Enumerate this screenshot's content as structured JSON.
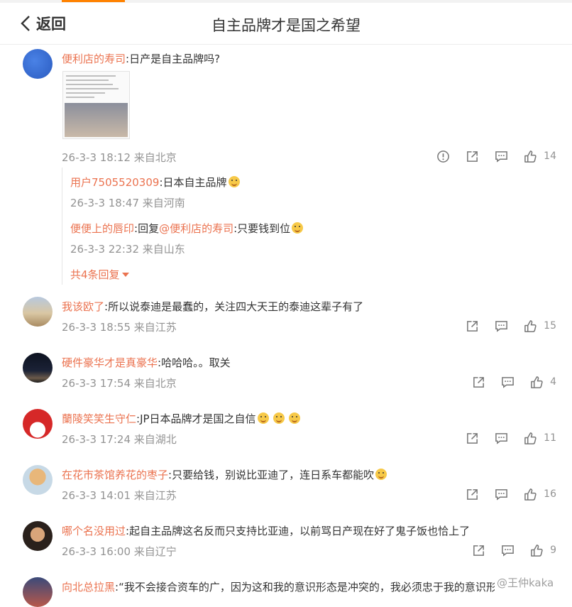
{
  "header": {
    "back_label": "返回",
    "title": "自主品牌才是国之希望"
  },
  "comments": [
    {
      "user": "便利店的寿司",
      "sep": ":",
      "text": "日产是自主品牌吗?",
      "meta": "26-3-3 18:12 来自北京",
      "likes": "14",
      "avatar_color": "#3a6fd8"
    },
    {
      "user": "我该欧了",
      "sep": ":",
      "text": "所以说泰迪是最蠢的，关注四大天王的泰迪这辈子有了",
      "meta": "26-3-3 18:55 来自江苏",
      "likes": "15"
    },
    {
      "user": "硬件豪华才是真豪华",
      "sep": ":",
      "text": "哈哈哈。。取关",
      "meta": "26-3-3 17:54 来自北京",
      "likes": "4"
    },
    {
      "user": "蘭陵笑笑生守仁",
      "sep": ":",
      "text": "JP日本品牌才是国之自信",
      "meta": "26-3-3 17:24 来自湖北",
      "likes": "11"
    },
    {
      "user": "在花市茶馆养花的枣子",
      "sep": ":",
      "text": "只要给钱，别说比亚迪了，连日系车都能吹",
      "meta": "26-3-3 14:01 来自江苏",
      "likes": "16"
    },
    {
      "user": "哪个名没用过",
      "sep": ":",
      "text": "起自主品牌这名反而只支持比亚迪，以前骂日产现在好了鬼子饭也恰上了",
      "meta": "26-3-3 16:00 来自辽宁",
      "likes": "9"
    },
    {
      "user": "向北总拉黑",
      "sep": ":",
      "text": "“我不会接合资车的广，因为这和我的意识形态是冲突的，我必须忠于我的意识形"
    }
  ],
  "replies": [
    {
      "user": "用户7505520309",
      "sep": ":",
      "text": "日本自主品牌",
      "meta": "26-3-3 18:47 来自河南"
    },
    {
      "user": "便便上的唇印",
      "sep": ":",
      "prefix": "回复",
      "mention": "@便利店的寿司",
      "text": ":只要钱到位",
      "meta": "26-3-3 22:32 来自山东"
    }
  ],
  "more_replies": "共4条回复",
  "watermark": "@王仲kaka",
  "colors": {
    "accent": "#ff8200",
    "username": "#eb7350",
    "meta": "#939393"
  }
}
